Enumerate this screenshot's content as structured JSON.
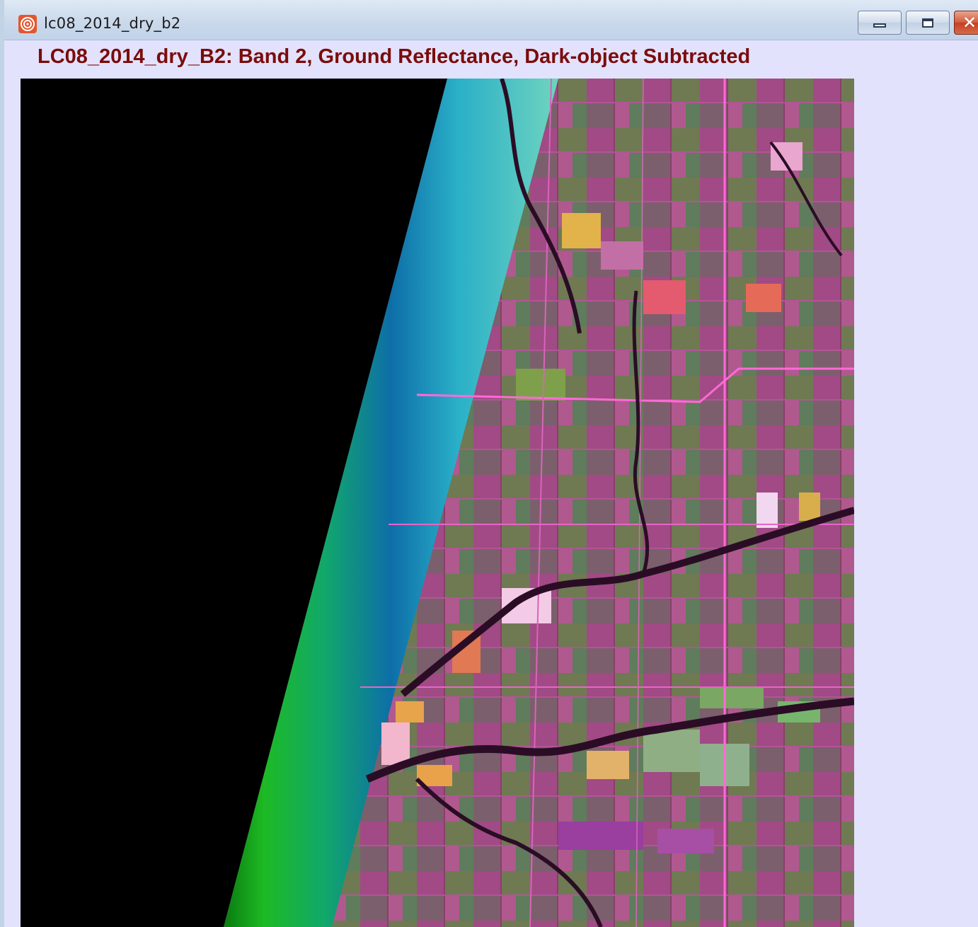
{
  "window": {
    "title": "lc08_2014_dry_b2",
    "icon": "idrisi-app-icon",
    "controls": {
      "minimize": "minimize-icon",
      "maximize": "maximize-icon",
      "close": "close-icon"
    }
  },
  "document": {
    "title": "LC08_2014_dry_B2: Band 2, Ground Reflectance, Dark-object Subtracted"
  },
  "colors": {
    "title_text": "#7b0c0c",
    "window_bg": "#e2e2fc",
    "nodata": "#000000"
  }
}
